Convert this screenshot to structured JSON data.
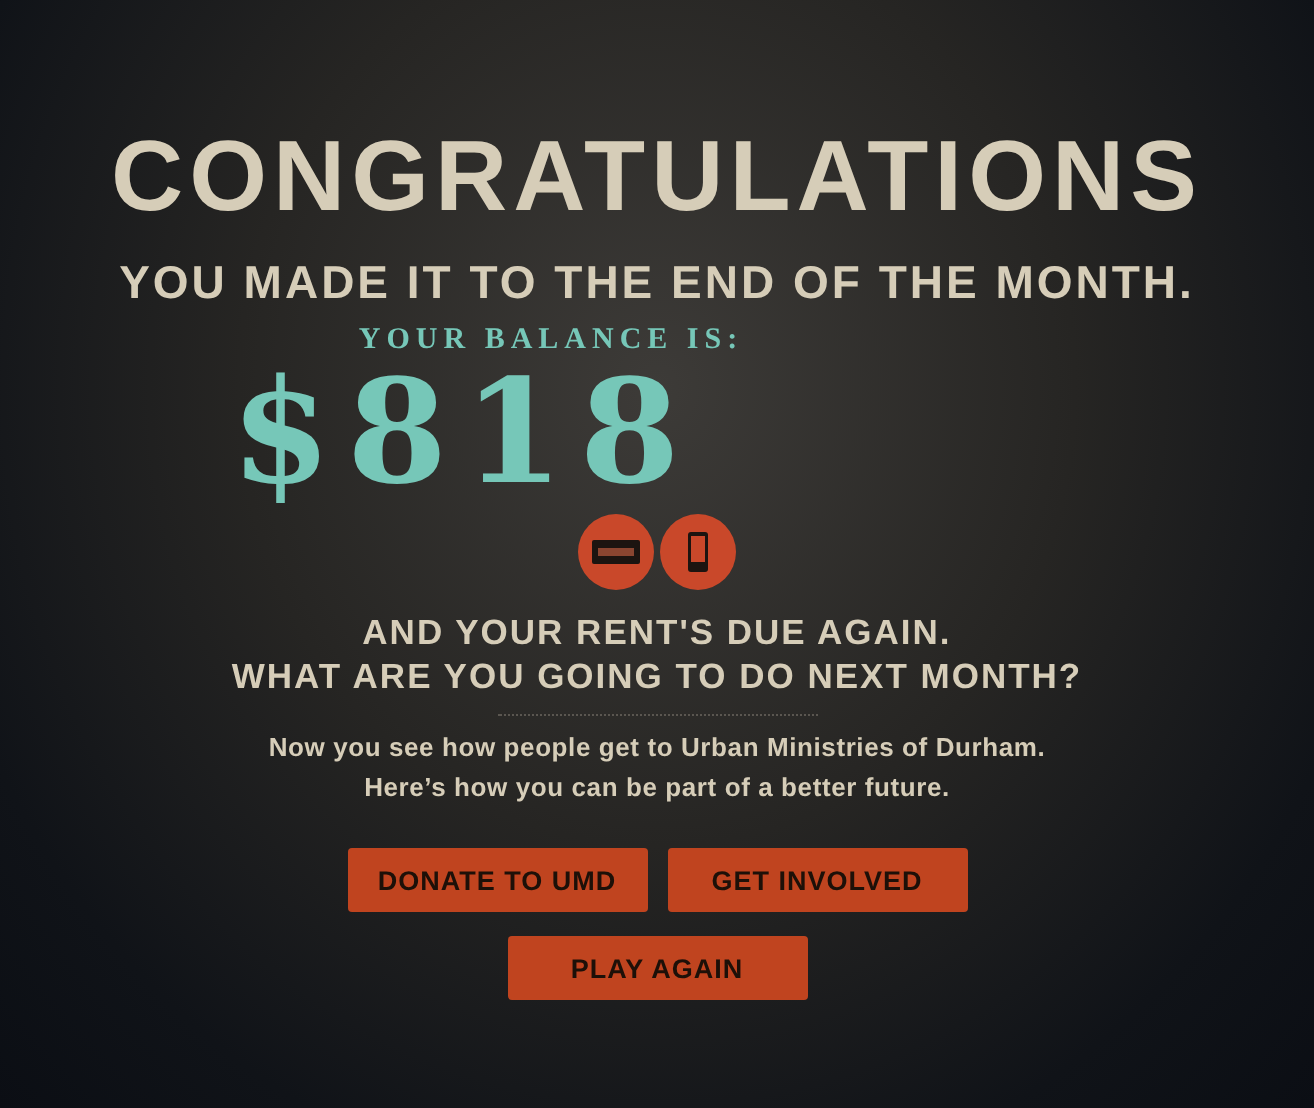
{
  "title": "CONGRATULATIONS",
  "subtitle": "YOU MADE IT TO THE END OF THE MONTH.",
  "balance_label": "YOUR BALANCE IS:",
  "balance": "$818",
  "badges": [
    {
      "kind": "card"
    },
    {
      "kind": "phone"
    }
  ],
  "question_lines": [
    "AND YOUR RENT'S DUE AGAIN.",
    "WHAT ARE YOU GOING TO DO NEXT MONTH?"
  ],
  "message_lines": [
    "Now you see how people get to Urban Ministries of Durham.",
    "Here’s how you can be part of a better future."
  ],
  "buttons": [
    {
      "label": "DONATE TO UMD"
    },
    {
      "label": "GET INVOLVED"
    },
    {
      "label": "PLAY AGAIN"
    }
  ]
}
